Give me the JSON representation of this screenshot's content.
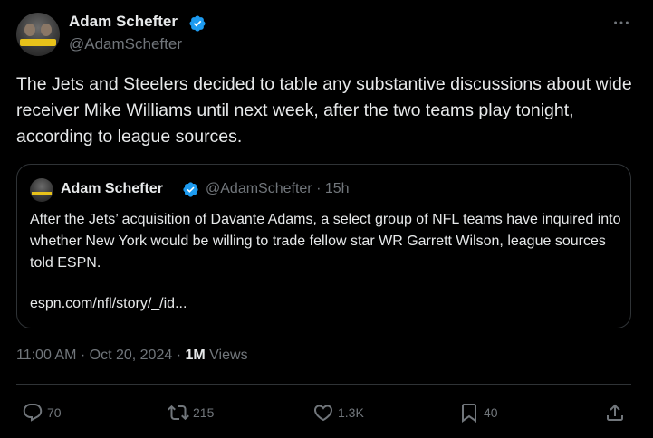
{
  "tweet": {
    "author_name": "Adam Schefter",
    "author_handle": "@AdamSchefter",
    "text": "The Jets and Steelers decided to table any substantive discussions about wide receiver Mike Williams until next week, after the two teams play tonight, according to league sources.",
    "timestamp": "11:00 AM · Oct 20, 2024",
    "views_count": "1M",
    "views_label": "Views"
  },
  "quote": {
    "author_name": "Adam Schefter",
    "author_handle": "@AdamSchefter",
    "age": "· 15h",
    "text": "After the Jets’ acquisition of Davante Adams, a select group of NFL teams have inquired into whether New York would be willing to trade fellow star WR Garrett Wilson, league sources told ESPN.",
    "link": "espn.com/nfl/story/_/id..."
  },
  "actions": {
    "replies": "70",
    "reposts": "215",
    "likes": "1.3K",
    "bookmarks": "40"
  },
  "colors": {
    "background": "#000000",
    "text_primary": "#e7e9ea",
    "text_secondary": "#71767b",
    "verified_blue": "#1d9bf0",
    "border": "#2f3336"
  },
  "icons": [
    "verified-badge-icon",
    "more-icon",
    "reply-icon",
    "repost-icon",
    "like-icon",
    "bookmark-icon",
    "share-icon"
  ]
}
